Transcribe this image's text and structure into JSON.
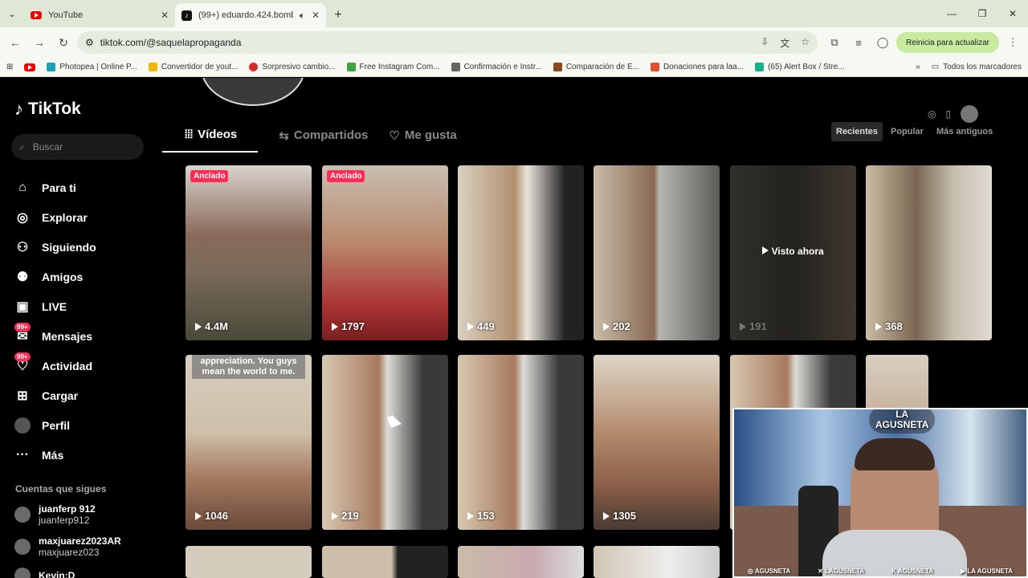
{
  "browser": {
    "tabs": [
      {
        "title": "YouTube",
        "icon": "youtube-icon"
      },
      {
        "title": "(99+) eduardo.424.bombo...",
        "icon": "tiktok-icon",
        "active": true
      }
    ],
    "url": "tiktok.com/@saquelapropaganda",
    "update_button": "Reinicia para actualizar",
    "bookmarks": [
      {
        "label": "Photopea | Online P...",
        "color": "#19a4b5"
      },
      {
        "label": "Convertidor de yout...",
        "color": "#f2b705"
      },
      {
        "label": "Sorpresivo cambio...",
        "color": "#d62b2b"
      },
      {
        "label": "Free Instagram Com...",
        "color": "#3fa33f"
      },
      {
        "label": "Confirmación e Instr...",
        "color": "#666666"
      },
      {
        "label": "Comparación de E...",
        "color": "#8b4a1c"
      },
      {
        "label": "Donaciones para laa...",
        "color": "#e04f2e"
      },
      {
        "label": "(65) Alert Box / Stre...",
        "color": "#18b08a"
      }
    ],
    "bookmarks_all": "Todos los marcadores"
  },
  "sidebar": {
    "brand": "TikTok",
    "search_placeholder": "Buscar",
    "nav": [
      {
        "label": "Para ti",
        "icon": "home-icon",
        "glyph": "⌂"
      },
      {
        "label": "Explorar",
        "icon": "compass-icon",
        "glyph": "◎"
      },
      {
        "label": "Siguiendo",
        "icon": "following-icon",
        "glyph": "⚇"
      },
      {
        "label": "Amigos",
        "icon": "friends-icon",
        "glyph": "⚉"
      },
      {
        "label": "LIVE",
        "icon": "live-icon",
        "glyph": "▣"
      },
      {
        "label": "Mensajes",
        "icon": "messages-icon",
        "glyph": "✉",
        "badge": "99+"
      },
      {
        "label": "Actividad",
        "icon": "activity-icon",
        "glyph": "♡",
        "badge": "99+"
      },
      {
        "label": "Cargar",
        "icon": "upload-icon",
        "glyph": "⊞"
      },
      {
        "label": "Perfil",
        "icon": "profile-avatar",
        "glyph": ""
      },
      {
        "label": "Más",
        "icon": "more-icon",
        "glyph": "···"
      }
    ],
    "following_title": "Cuentas que sigues",
    "following": [
      {
        "name": "juanferp 912",
        "handle": "juanferp912"
      },
      {
        "name": "maxjuarez2023AR",
        "handle": "maxjuarez023"
      },
      {
        "name": "Kevin:D",
        "handle": ""
      }
    ]
  },
  "profile": {
    "tabs": [
      "Vídeos",
      "Compartidos",
      "Me gusta"
    ],
    "sort": [
      "Recientes",
      "Popular",
      "Más antiguos"
    ]
  },
  "videos": [
    {
      "views": "4.4M",
      "pinned": "Anclado",
      "color": "#8a7a6a"
    },
    {
      "views": "1797",
      "pinned": "Anclado",
      "color": "#9a6a4a"
    },
    {
      "views": "449",
      "color": "#cfc6b5"
    },
    {
      "views": "202",
      "color": "#b7ab98"
    },
    {
      "views": "191",
      "watched": "Visto ahora",
      "color": "#5a5a52"
    },
    {
      "views": "368",
      "color": "#8d8a78"
    },
    {
      "views": "1046",
      "caption": "appreciation. You guys mean the world to me.",
      "color": "#cfc4b3"
    },
    {
      "views": "219",
      "color": "#c9bda8"
    },
    {
      "views": "153",
      "color": "#c9bda8"
    },
    {
      "views": "1305",
      "color": "#d0c5b2"
    },
    {
      "views": "",
      "color": "#bdb3a2"
    },
    {
      "views": "",
      "color": "#b8ad9a"
    }
  ],
  "webcam": {
    "brand_line1": "LA",
    "brand_line2": "AGUSNETA",
    "socials": [
      "AGUSNETA",
      "LAGUSNETA",
      "AGUSNETA",
      "LA AGUSNETA"
    ]
  }
}
